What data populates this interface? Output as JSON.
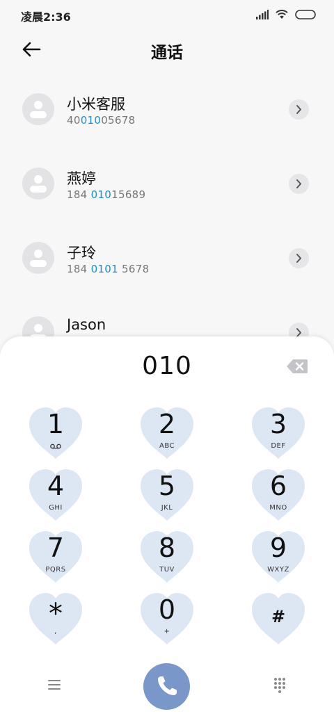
{
  "status_bar": {
    "time": "凌晨2:36"
  },
  "header": {
    "title": "通话"
  },
  "contacts": [
    {
      "name": "小米客服",
      "number_parts": [
        "40",
        "010",
        "05678"
      ]
    },
    {
      "name": "燕婷",
      "number_parts": [
        "184 ",
        "010",
        "15689"
      ]
    },
    {
      "name": "子玲",
      "number_parts": [
        "184 ",
        "0101",
        " 5678"
      ]
    },
    {
      "name": "Jason",
      "number_parts": [
        "",
        "",
        ""
      ]
    }
  ],
  "dialpad": {
    "input": "010",
    "keys": [
      {
        "digit": "1",
        "sub": ""
      },
      {
        "digit": "2",
        "sub": "ABC"
      },
      {
        "digit": "3",
        "sub": "DEF"
      },
      {
        "digit": "4",
        "sub": "GHI"
      },
      {
        "digit": "5",
        "sub": "JKL"
      },
      {
        "digit": "6",
        "sub": "MNO"
      },
      {
        "digit": "7",
        "sub": "PQRS"
      },
      {
        "digit": "8",
        "sub": "TUV"
      },
      {
        "digit": "9",
        "sub": "WXYZ"
      },
      {
        "digit": "*",
        "sub": ","
      },
      {
        "digit": "0",
        "sub": "+"
      },
      {
        "digit": "#",
        "sub": ""
      }
    ]
  },
  "colors": {
    "highlight": "#1a8fd8",
    "key_fill": "#dde6f3",
    "call_button": "#7a97c9"
  }
}
